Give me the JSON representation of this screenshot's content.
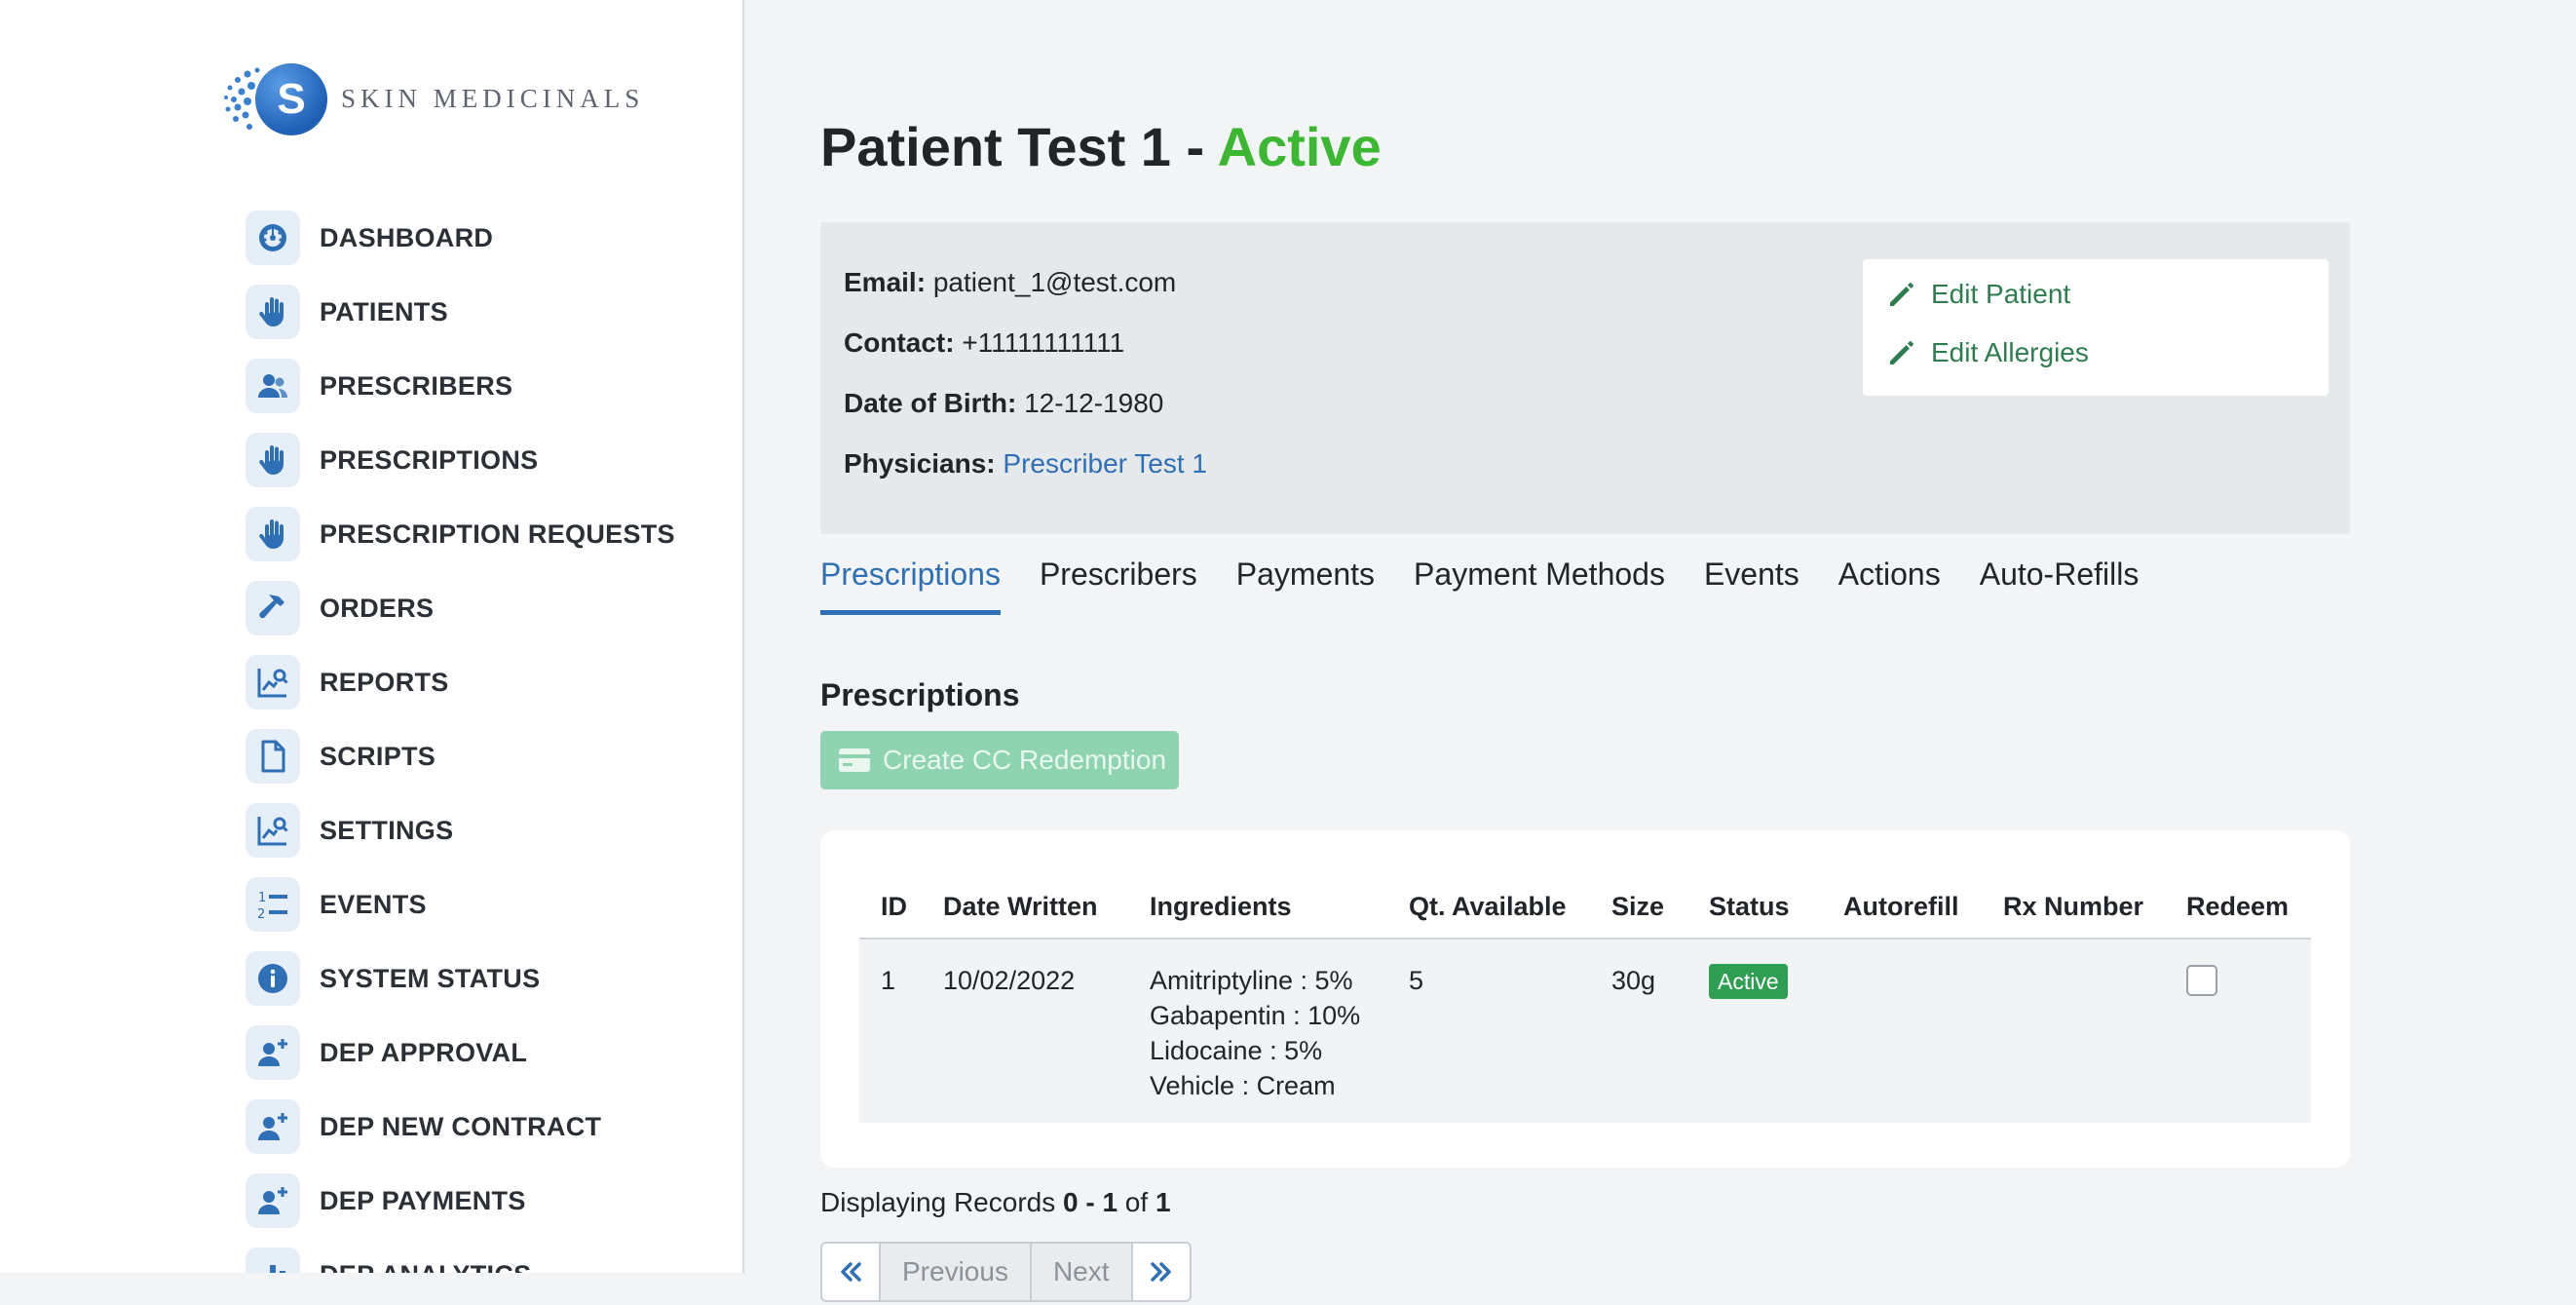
{
  "brand": {
    "letter": "S",
    "name": "SKIN MEDICINALS"
  },
  "sidebar": {
    "items": [
      {
        "label": "DASHBOARD",
        "icon": "dashboard-icon"
      },
      {
        "label": "PATIENTS",
        "icon": "hand-icon"
      },
      {
        "label": "PRESCRIBERS",
        "icon": "users-icon"
      },
      {
        "label": "PRESCRIPTIONS",
        "icon": "hand-icon"
      },
      {
        "label": "PRESCRIPTION REQUESTS",
        "icon": "hand-icon"
      },
      {
        "label": "ORDERS",
        "icon": "hammer-icon"
      },
      {
        "label": "REPORTS",
        "icon": "chart-search-icon"
      },
      {
        "label": "SCRIPTS",
        "icon": "file-icon"
      },
      {
        "label": "SETTINGS",
        "icon": "chart-search-icon"
      },
      {
        "label": "EVENTS",
        "icon": "numbered-list-icon"
      },
      {
        "label": "SYSTEM STATUS",
        "icon": "info-icon"
      },
      {
        "label": "DEP APPROVAL",
        "icon": "user-plus-icon"
      },
      {
        "label": "DEP NEW CONTRACT",
        "icon": "user-plus-icon"
      },
      {
        "label": "DEP PAYMENTS",
        "icon": "user-plus-icon"
      },
      {
        "label": "DEP ANALYTICS",
        "icon": "bar-chart-icon"
      }
    ]
  },
  "header": {
    "patient_name": "Patient Test 1",
    "separator": " - ",
    "status": "Active",
    "status_color": "#3cb732"
  },
  "patient": {
    "email_label": "Email:",
    "email": "patient_1@test.com",
    "contact_label": "Contact:",
    "contact": "+11111111111",
    "dob_label": "Date of Birth:",
    "dob": "12-12-1980",
    "physicians_label": "Physicians:",
    "physician": "Prescriber Test 1"
  },
  "actions": {
    "edit_patient": "Edit Patient",
    "edit_allergies": "Edit Allergies"
  },
  "tabs": [
    {
      "label": "Prescriptions",
      "active": true
    },
    {
      "label": "Prescribers"
    },
    {
      "label": "Payments"
    },
    {
      "label": "Payment Methods"
    },
    {
      "label": "Events"
    },
    {
      "label": "Actions"
    },
    {
      "label": "Auto-Refills"
    }
  ],
  "section": {
    "title": "Prescriptions",
    "cc_button": "Create CC Redemption"
  },
  "table": {
    "headers": [
      "ID",
      "Date Written",
      "Ingredients",
      "Qt. Available",
      "Size",
      "Status",
      "Autorefill",
      "Rx Number",
      "Redeem"
    ],
    "rows": [
      {
        "id": "1",
        "date_written": "10/02/2022",
        "ingredients": [
          "Amitriptyline : 5%",
          "Gabapentin : 10%",
          "Lidocaine : 5%",
          "Vehicle : Cream"
        ],
        "qty_available": "5",
        "size": "30g",
        "status": "Active",
        "autorefill": "",
        "rx_number": "",
        "redeem_checked": false
      }
    ]
  },
  "pagination": {
    "prefix": "Displaying Records ",
    "range": "0 - 1",
    "of": " of ",
    "total": "1",
    "previous": "Previous",
    "next": "Next"
  },
  "colors": {
    "accent": "#2f6fb5",
    "action_green": "#2e7d4f",
    "badge_green": "#2e9e52"
  }
}
